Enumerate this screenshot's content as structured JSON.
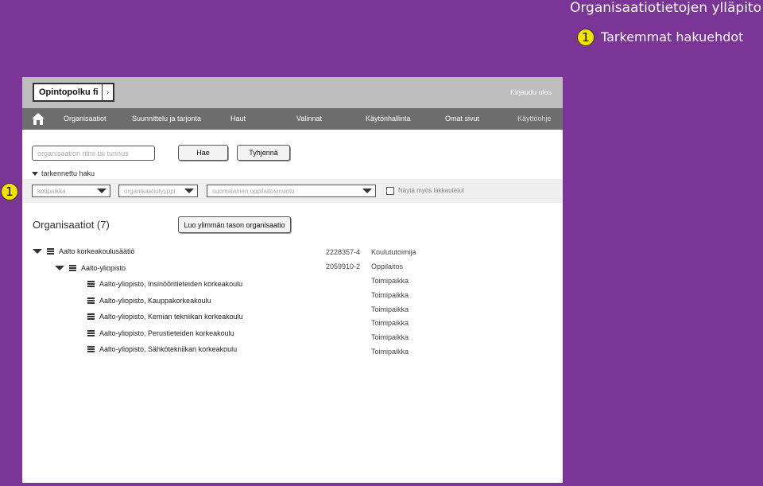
{
  "annotation": {
    "title": "Organisaatiotietojen ylläpito",
    "marker": "1",
    "note": "Tarkemmat hakuehdot"
  },
  "header": {
    "logo": "Opintopolku fi",
    "logo_arrow": "›",
    "logout": "Kirjaudu ulos"
  },
  "nav": {
    "items": [
      "Organisaatiot",
      "Suunnittelu ja tarjonta",
      "Haut",
      "Valinnat",
      "Käytönhallinta",
      "Omat sivut",
      "Käyttöohje"
    ]
  },
  "search": {
    "placeholder": "organisaation nimi tai tunnus",
    "search_label": "Hae",
    "clear_label": "Tyhjennä",
    "advanced_label": "tarkennettu haku"
  },
  "filters": {
    "municipality": "kotipaikka",
    "org_type": "organisaatiotyyppi",
    "language": "suomalainen oppilaitosmuoto",
    "show_closed": "Näytä myös lakkautetut"
  },
  "orgs": {
    "title": "Organisaatiot (7)",
    "create_label": "Luo ylimmän tason organisaatio",
    "tree": [
      {
        "name": "Aalto korkeakoulusäätiö",
        "code": "2228357-4",
        "type": "Koulututoimija"
      },
      {
        "name": "Aalto-yliopisto",
        "code": "2059910-2",
        "type": "Oppilaitos"
      },
      {
        "name": "Aalto-yliopisto, Insinööritieteiden korkeakoulu",
        "code": "",
        "type": "Toimipaikka"
      },
      {
        "name": "Aalto-yliopisto, Kauppakorkeakoulu",
        "code": "",
        "type": "Toimipaikka"
      },
      {
        "name": "Aalto-yliopisto, Kemian tekniikan korkeakoulu",
        "code": "",
        "type": "Toimipaikka"
      },
      {
        "name": "Aalto-yliopisto, Perustieteiden korkeakoulu",
        "code": "",
        "type": "Toimipaikka"
      },
      {
        "name": "Aalto-yliopisto, Sähkötekniikan korkeakoulu",
        "code": "",
        "type": "Toimipaikka"
      }
    ],
    "extra_types": [
      "Toimipaikka"
    ]
  }
}
